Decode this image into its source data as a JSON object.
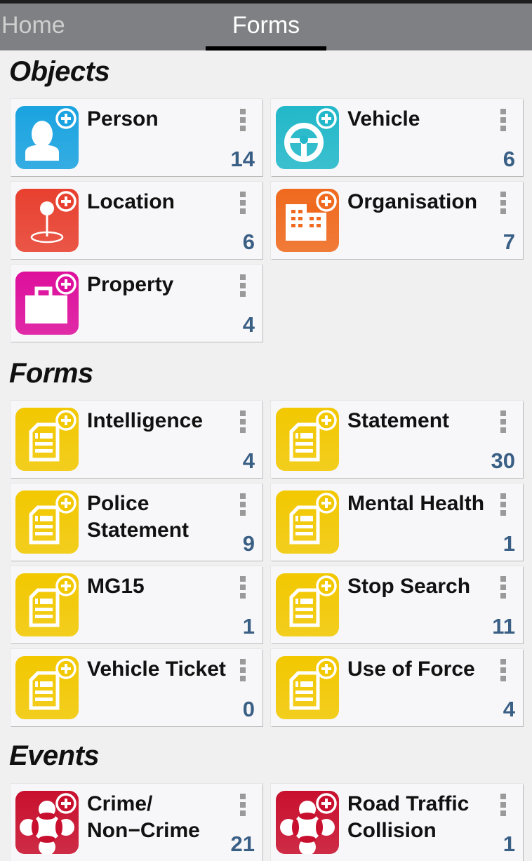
{
  "tabs": [
    {
      "label": "Home",
      "active": false
    },
    {
      "label": "Forms",
      "active": true
    }
  ],
  "sections": [
    {
      "title": "Objects",
      "items": [
        {
          "label": "Person",
          "count": "14",
          "icon": "person-add-icon",
          "color": "#1aa3e0"
        },
        {
          "label": "Vehicle",
          "count": "6",
          "icon": "steering-wheel-add-icon",
          "color": "#22b8c9"
        },
        {
          "label": "Location",
          "count": "6",
          "icon": "map-pin-add-icon",
          "color": "#e8402f"
        },
        {
          "label": "Organisation",
          "count": "7",
          "icon": "building-add-icon",
          "color": "#ef6a1e"
        },
        {
          "label": "Property",
          "count": "4",
          "icon": "briefcase-add-icon",
          "color": "#dd0f9c"
        }
      ]
    },
    {
      "title": "Forms",
      "items": [
        {
          "label": "Intelligence",
          "count": "4",
          "icon": "form-add-icon",
          "color": "#f2c800"
        },
        {
          "label": "Statement",
          "count": "30",
          "icon": "form-add-icon",
          "color": "#f2c800"
        },
        {
          "label": "Police Statement",
          "count": "9",
          "icon": "form-add-icon",
          "color": "#f2c800"
        },
        {
          "label": "Mental Health",
          "count": "1",
          "icon": "form-add-icon",
          "color": "#f2c800"
        },
        {
          "label": "MG15",
          "count": "1",
          "icon": "form-add-icon",
          "color": "#f2c800"
        },
        {
          "label": "Stop Search",
          "count": "11",
          "icon": "form-add-icon",
          "color": "#f2c800"
        },
        {
          "label": "Vehicle Ticket",
          "count": "0",
          "icon": "form-add-icon",
          "color": "#f2c800"
        },
        {
          "label": "Use of Force",
          "count": "4",
          "icon": "form-add-icon",
          "color": "#f2c800"
        }
      ]
    },
    {
      "title": "Events",
      "items": [
        {
          "label": "Crime/ Non−Crime",
          "count": "21",
          "icon": "event-add-icon",
          "color": "#c8102e"
        },
        {
          "label": "Road Traffic Collision",
          "count": "1",
          "icon": "event-add-icon",
          "color": "#c8102e"
        }
      ]
    }
  ]
}
